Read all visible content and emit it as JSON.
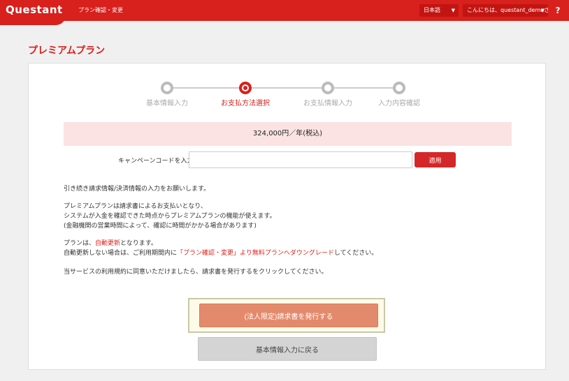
{
  "header": {
    "logo": "Questant",
    "nav_link": "プラン確認・変更",
    "language": "日本語",
    "greeting": "こんにちは、questant_demoさん",
    "help": "?"
  },
  "page_title": "プレミアムプラン",
  "steps": [
    {
      "label": "基本情報入力",
      "active": false
    },
    {
      "label": "お支払方法選択",
      "active": true
    },
    {
      "label": "お支払情報入力",
      "active": false
    },
    {
      "label": "入力内容確認",
      "active": false
    }
  ],
  "price": "324,000円／年(税込)",
  "campaign": {
    "label": "キャンペーンコードを入力",
    "value": "",
    "placeholder": "",
    "apply_label": "適用"
  },
  "messages": {
    "line1": "引き続き請求情報/決済情報の入力をお願いします。",
    "line2": "プレミアムプランは請求書によるお支払いとなり、",
    "line3": "システムが入金を確認できた時点からプレミアムプランの機能が使えます。",
    "line4": "(金融機関の営業時間によって、確認に時間がかかる場合があります)",
    "line5_pre": "プランは、",
    "line5_link": "自動更新",
    "line5_post": "となります。",
    "line6_pre": "自動更新しない場合は、ご利用期間内に",
    "line6_link": "「プラン確認・変更」より無料プランへダウングレード",
    "line6_post": "してください。",
    "line7": "当サービスの利用規約に同意いただけましたら、請求書を発行するをクリックしてください。"
  },
  "buttons": {
    "issue": "(法人限定)請求書を発行する",
    "back": "基本情報入力に戻る"
  },
  "colors": {
    "brand": "#d8201c",
    "price_bg": "#fbe3e3",
    "issue_button": "#e48a6c"
  }
}
